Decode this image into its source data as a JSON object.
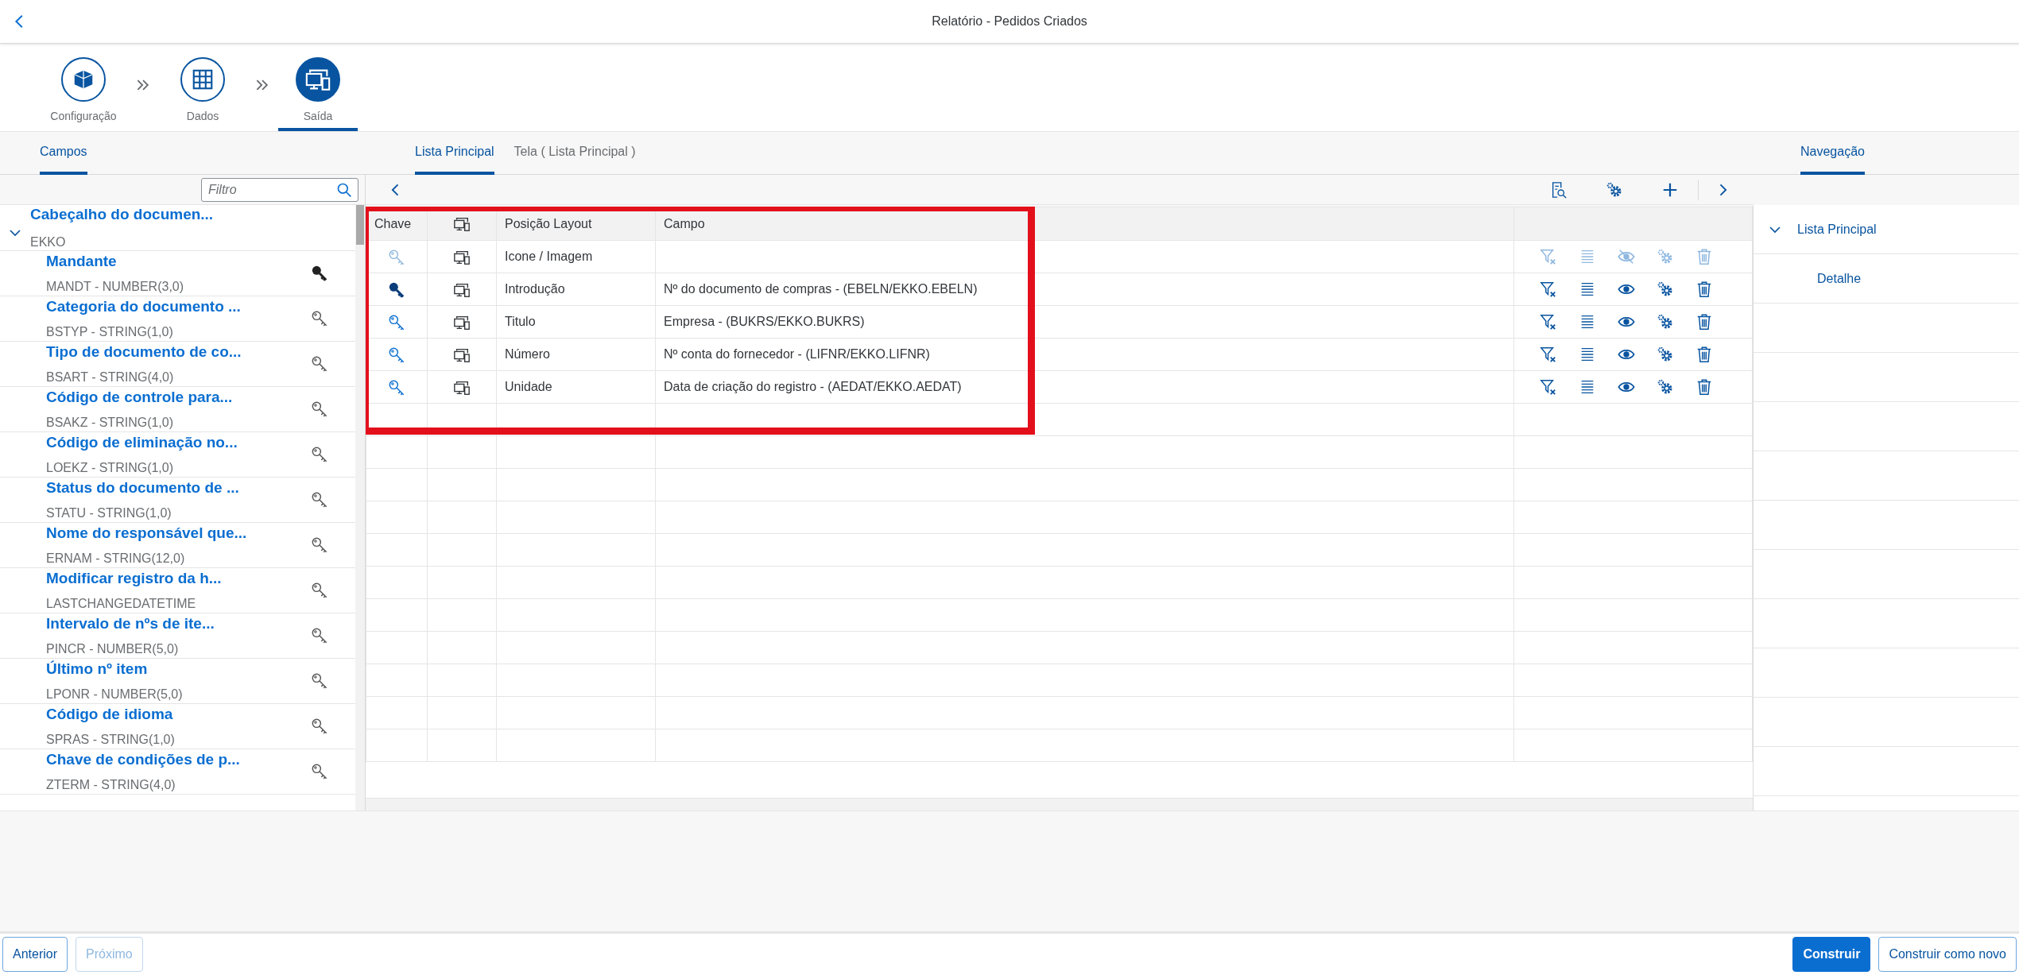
{
  "header": {
    "title": "Relatório - Pedidos Criados"
  },
  "steps": [
    {
      "label": "Configuração",
      "selected": false
    },
    {
      "label": "Dados",
      "selected": false
    },
    {
      "label": "Saída",
      "selected": true
    }
  ],
  "fields_panel": {
    "tabs": [
      {
        "label": "Campos",
        "selected": true
      }
    ],
    "filter": {
      "placeholder": "Filtro"
    },
    "tree": [
      {
        "label": "Cabeçalho do documen...",
        "sublabel": "EKKO",
        "expanded": true,
        "children": [
          {
            "label": "Mandante",
            "sublabel": "MANDT - NUMBER(3,0)",
            "key": true
          },
          {
            "label": "Categoria do documento ...",
            "sublabel": "BSTYP - STRING(1,0)",
            "key": false
          },
          {
            "label": "Tipo de documento de co...",
            "sublabel": "BSART - STRING(4,0)",
            "key": false
          },
          {
            "label": "Código de controle para...",
            "sublabel": "BSAKZ - STRING(1,0)",
            "key": false
          },
          {
            "label": "Código de eliminação no...",
            "sublabel": "LOEKZ - STRING(1,0)",
            "key": false
          },
          {
            "label": "Status do documento de ...",
            "sublabel": "STATU - STRING(1,0)",
            "key": false
          },
          {
            "label": "Nome do responsável que...",
            "sublabel": "ERNAM - STRING(12,0)",
            "key": false
          },
          {
            "label": "Modificar registro da h...",
            "sublabel": "LASTCHANGEDATETIME",
            "key": false
          },
          {
            "label": "Intervalo de nºs de ite...",
            "sublabel": "PINCR - NUMBER(5,0)",
            "key": false
          },
          {
            "label": "Último nº item",
            "sublabel": "LPONR - NUMBER(5,0)",
            "key": false
          },
          {
            "label": "Código de idioma",
            "sublabel": "SPRAS - STRING(1,0)",
            "key": false
          },
          {
            "label": "Chave de condições de p...",
            "sublabel": "ZTERM - STRING(4,0)",
            "key": false
          }
        ]
      }
    ]
  },
  "layout_panel": {
    "tabs": [
      {
        "label": "Lista Principal",
        "selected": true
      },
      {
        "label": "Tela ( Lista Principal )",
        "selected": false
      }
    ],
    "table": {
      "columns": [
        {
          "kind": "text",
          "label": "Chave"
        },
        {
          "kind": "icon"
        },
        {
          "kind": "text",
          "label": "Posição Layout"
        },
        {
          "kind": "text",
          "label": "Campo"
        },
        {
          "kind": "blank"
        }
      ],
      "rows": [
        {
          "position": "Icone / Imagem",
          "key": false,
          "disabled": true,
          "visible": false
        },
        {
          "position": "Introdução",
          "field": "Nº do documento de compras - (EBELN/EKKO.EBELN)",
          "key": true,
          "disabled": false,
          "visible": true
        },
        {
          "position": "Titulo",
          "field": "Empresa - (BUKRS/EKKO.BUKRS)",
          "key": false,
          "disabled": false,
          "visible": true
        },
        {
          "position": "Número",
          "field": "Nº conta do fornecedor - (LIFNR/EKKO.LIFNR)",
          "key": false,
          "disabled": false,
          "visible": true
        },
        {
          "position": "Unidade",
          "field": "Data de criação do registro - (AEDAT/EKKO.AEDAT)",
          "key": false,
          "disabled": false,
          "visible": true
        }
      ]
    }
  },
  "navigation_panel": {
    "tabs": [
      {
        "label": "Navegação",
        "selected": true
      }
    ],
    "items": [
      {
        "label": "Lista Principal",
        "expanded": true,
        "children": [
          {
            "label": "Detalhe"
          }
        ]
      }
    ]
  },
  "footer": {
    "left_buttons": [
      {
        "label": "Anterior",
        "kind": "default",
        "disabled": false
      },
      {
        "label": "Próximo",
        "kind": "default",
        "disabled": true
      }
    ],
    "right_buttons": [
      {
        "label": "Construir",
        "kind": "emphasized",
        "disabled": false
      },
      {
        "label": "Construir como novo",
        "kind": "default",
        "disabled": false
      }
    ]
  }
}
